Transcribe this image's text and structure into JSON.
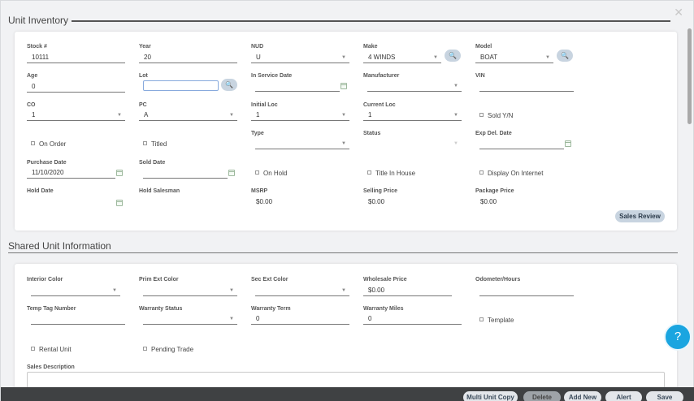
{
  "sections": {
    "unit_inventory": "Unit Inventory",
    "shared_unit_information": "Shared Unit Information"
  },
  "close_icon": "✕",
  "fields": {
    "stock": {
      "label": "Stock #",
      "value": "10111"
    },
    "year": {
      "label": "Year",
      "value": "20"
    },
    "nud": {
      "label": "NUD",
      "value": "U"
    },
    "make": {
      "label": "Make",
      "value": "4 WINDS"
    },
    "model": {
      "label": "Model",
      "value": "BOAT"
    },
    "age": {
      "label": "Age",
      "value": "0"
    },
    "lot": {
      "label": "Lot",
      "value": ""
    },
    "in_service_date": {
      "label": "In Service Date",
      "value": ""
    },
    "manufacturer": {
      "label": "Manufacturer",
      "value": ""
    },
    "vin": {
      "label": "VIN",
      "value": ""
    },
    "co": {
      "label": "CO",
      "value": "1"
    },
    "pc": {
      "label": "PC",
      "value": "A"
    },
    "initial_loc": {
      "label": "Initial Loc",
      "value": "1"
    },
    "current_loc": {
      "label": "Current Loc",
      "value": "1"
    },
    "type": {
      "label": "Type",
      "value": ""
    },
    "status": {
      "label": "Status",
      "value": ""
    },
    "exp_del_date": {
      "label": "Exp Del. Date",
      "value": ""
    },
    "purchase_date": {
      "label": "Purchase Date",
      "value": "11/10/2020"
    },
    "sold_date": {
      "label": "Sold Date",
      "value": ""
    },
    "hold_date": {
      "label": "Hold Date",
      "value": ""
    },
    "hold_salesman": {
      "label": "Hold Salesman",
      "value": ""
    },
    "msrp": {
      "label": "MSRP",
      "value": "$0.00"
    },
    "selling_price": {
      "label": "Selling Price",
      "value": "$0.00"
    },
    "package_price": {
      "label": "Package Price",
      "value": "$0.00"
    }
  },
  "checkboxes": {
    "sold_yn": "Sold Y/N",
    "on_order": "On Order",
    "titled": "Titled",
    "on_hold": "On Hold",
    "title_in_house": "Title In House",
    "display_on_internet": "Display On Internet"
  },
  "sales_review_label": "Sales Review",
  "shared": {
    "interior_color": {
      "label": "Interior Color",
      "value": ""
    },
    "prim_ext_color": {
      "label": "Prim Ext Color",
      "value": ""
    },
    "sec_ext_color": {
      "label": "Sec Ext Color",
      "value": ""
    },
    "wholesale_price": {
      "label": "Wholesale Price",
      "value": "$0.00"
    },
    "odometer_hours": {
      "label": "Odometer/Hours",
      "value": ""
    },
    "temp_tag_number": {
      "label": "Temp Tag Number",
      "value": ""
    },
    "warranty_status": {
      "label": "Warranty Status",
      "value": ""
    },
    "warranty_term": {
      "label": "Warranty Term",
      "value": "0"
    },
    "warranty_miles": {
      "label": "Warranty Miles",
      "value": "0"
    },
    "template": "Template",
    "rental_unit": "Rental Unit",
    "pending_trade": "Pending Trade",
    "sales_description": "Sales Description"
  },
  "footer": {
    "multi_unit_copy": "Multi Unit Copy",
    "delete": "Delete",
    "add_new": "Add New",
    "alert": "Alert",
    "save": "Save"
  },
  "help_icon": "?",
  "search_glyph": "🔍",
  "dropdown_caret": "▼"
}
